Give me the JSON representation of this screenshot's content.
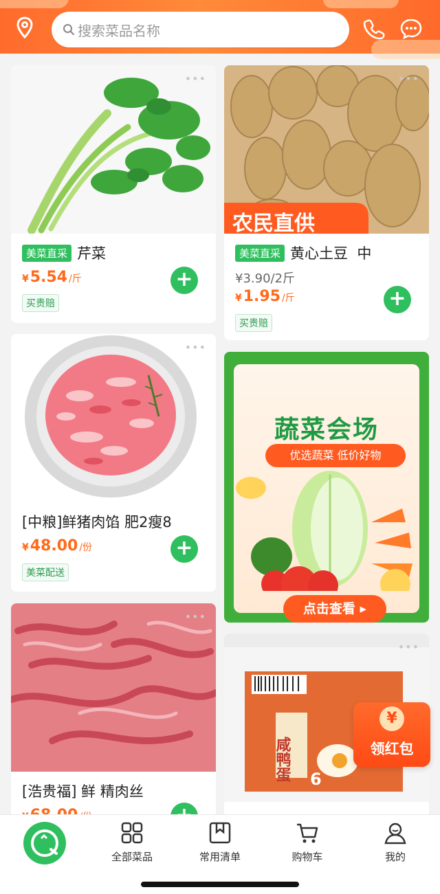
{
  "header": {
    "search_placeholder": "搜索菜品名称",
    "icons": [
      "location-icon",
      "search-icon",
      "phone-icon",
      "chat-icon"
    ]
  },
  "products": [
    {
      "tag": "美菜直采",
      "name": "芹菜",
      "price_currency": "¥",
      "price": "5.54",
      "unit": "/斤",
      "badge": "买贵赔"
    },
    {
      "tag": "美菜直采",
      "name": "黄心土豆  中",
      "original_price": "¥3.90/2斤",
      "price_currency": "¥",
      "price": "1.95",
      "unit": "/斤",
      "badge": "买贵赔",
      "image_text": "农民直供"
    },
    {
      "name": "[中粮]鲜猪肉馅 肥2瘦8",
      "price_currency": "¥",
      "price": "48.00",
      "unit": "/份",
      "badge": "美菜配送"
    },
    {
      "name": "[浩贵福] 鲜 精肉丝",
      "price_currency": "¥",
      "price": "68.00",
      "unit": "/份"
    }
  ],
  "banner": {
    "title": "蔬菜会场",
    "subtitle": "优选蔬菜 低价好物",
    "cta": "点击查看"
  },
  "egg_product": {
    "package_text": "咸鸭蛋",
    "count_text": "6"
  },
  "red_packet": {
    "symbol": "¥",
    "label": "领红包"
  },
  "nav": {
    "items": [
      {
        "label": "全部菜品",
        "icon": "grid-icon"
      },
      {
        "label": "常用清单",
        "icon": "bookmark-icon"
      },
      {
        "label": "购物车",
        "icon": "cart-icon"
      },
      {
        "label": "我的",
        "icon": "user-icon"
      }
    ]
  },
  "colors": {
    "header_orange": "#ff6b2c",
    "green": "#2fbf5f",
    "price_orange": "#ff6a1a"
  }
}
